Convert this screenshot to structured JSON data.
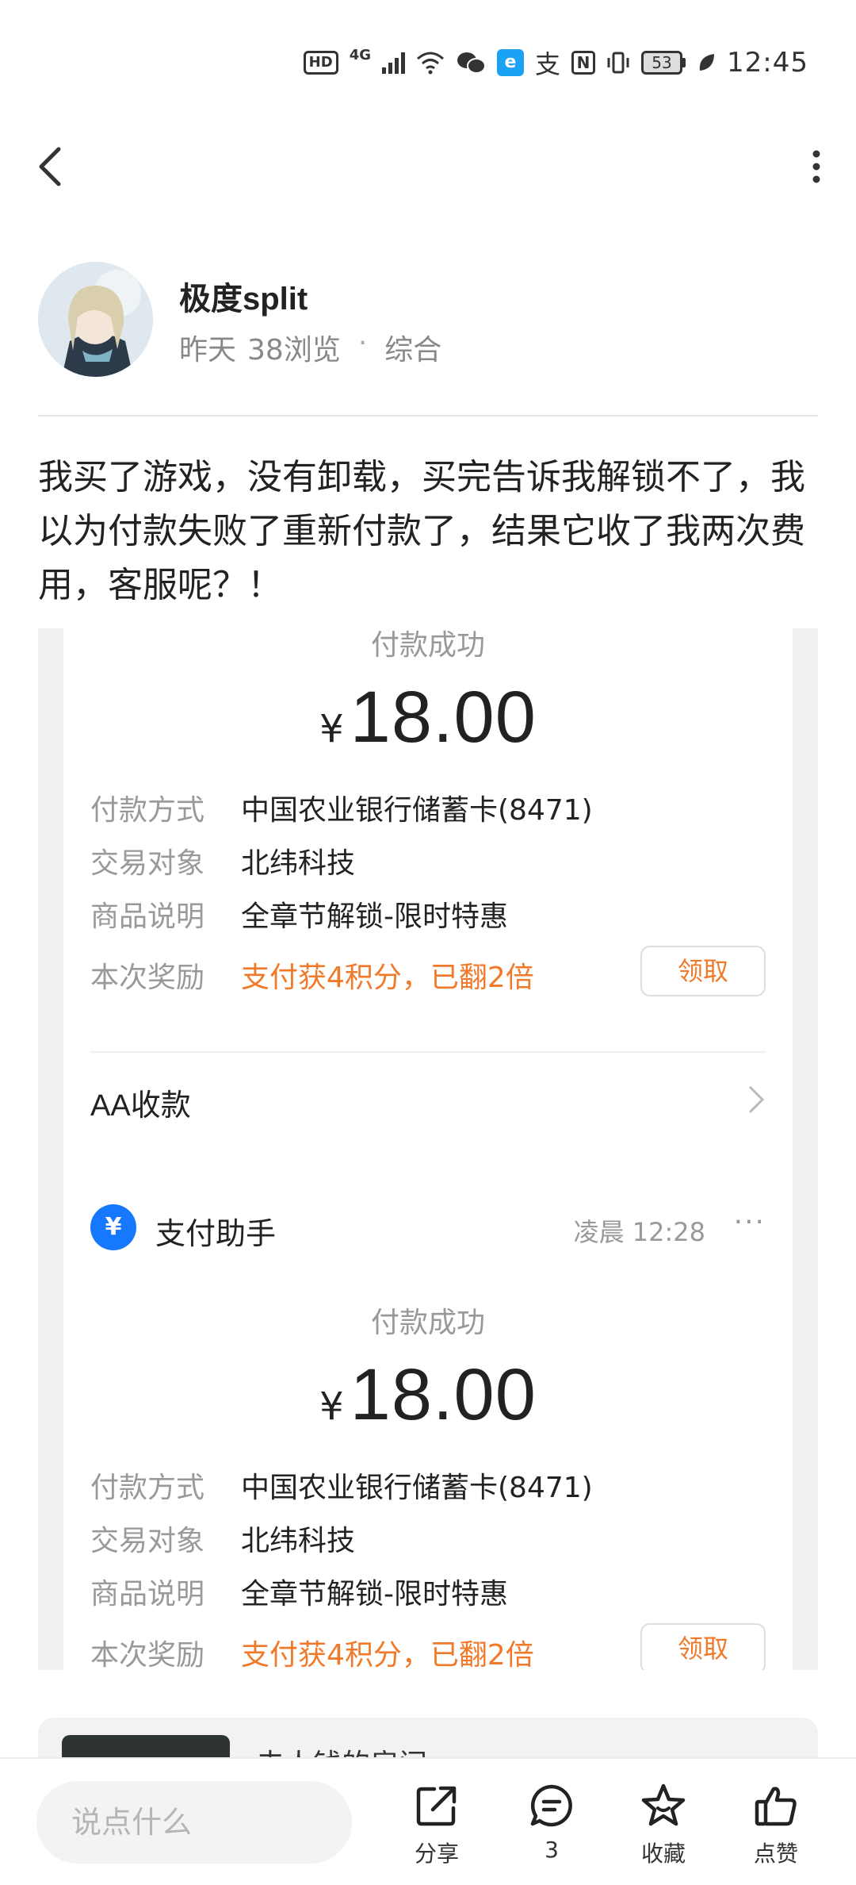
{
  "status_bar": {
    "hd": "HD",
    "network": "4G",
    "app_label": "e",
    "zhi": "支",
    "nfc": "N",
    "battery": "53",
    "time": "12:45"
  },
  "author": {
    "name": "极度split",
    "date": "昨天",
    "views": "38浏览",
    "separator": "·",
    "category": "综合"
  },
  "post": {
    "text": "我买了游戏，没有卸载，买完告诉我解锁不了，我以为付款失败了重新付款了，结果它收了我两次费用，客服呢？！"
  },
  "receipt1": {
    "status": "付款成功",
    "currency": "¥",
    "amount": "18.00",
    "rows": [
      {
        "label": "付款方式",
        "value": "中国农业银行储蓄卡(8471)"
      },
      {
        "label": "交易对象",
        "value": "北纬科技"
      },
      {
        "label": "商品说明",
        "value": "全章节解锁-限时特惠"
      },
      {
        "label": "本次奖励",
        "value": "支付获4积分，已翻2倍"
      }
    ],
    "claim_label": "领取",
    "aa_label": "AA收款"
  },
  "receipt2": {
    "assistant_icon": "¥",
    "assistant_name": "支付助手",
    "time": "凌晨 12:28",
    "more": "···",
    "status": "付款成功",
    "currency": "¥",
    "amount": "18.00",
    "rows": [
      {
        "label": "付款方式",
        "value": "中国农业银行储蓄卡(8471)"
      },
      {
        "label": "交易对象",
        "value": "北纬科技"
      },
      {
        "label": "商品说明",
        "value": "全章节解锁-限时特惠"
      },
      {
        "label": "本次奖励",
        "value": "支付获4积分，已翻2倍"
      }
    ],
    "claim_label": "领取"
  },
  "related": {
    "title": "夫人钱的房间"
  },
  "bottom_bar": {
    "comment_placeholder": "说点什么",
    "share_label": "分享",
    "comment_count": "3",
    "favorite_label": "收藏",
    "like_label": "点赞"
  },
  "colors": {
    "accent_orange": "#f07a2a",
    "assist_blue": "#1677ff"
  }
}
